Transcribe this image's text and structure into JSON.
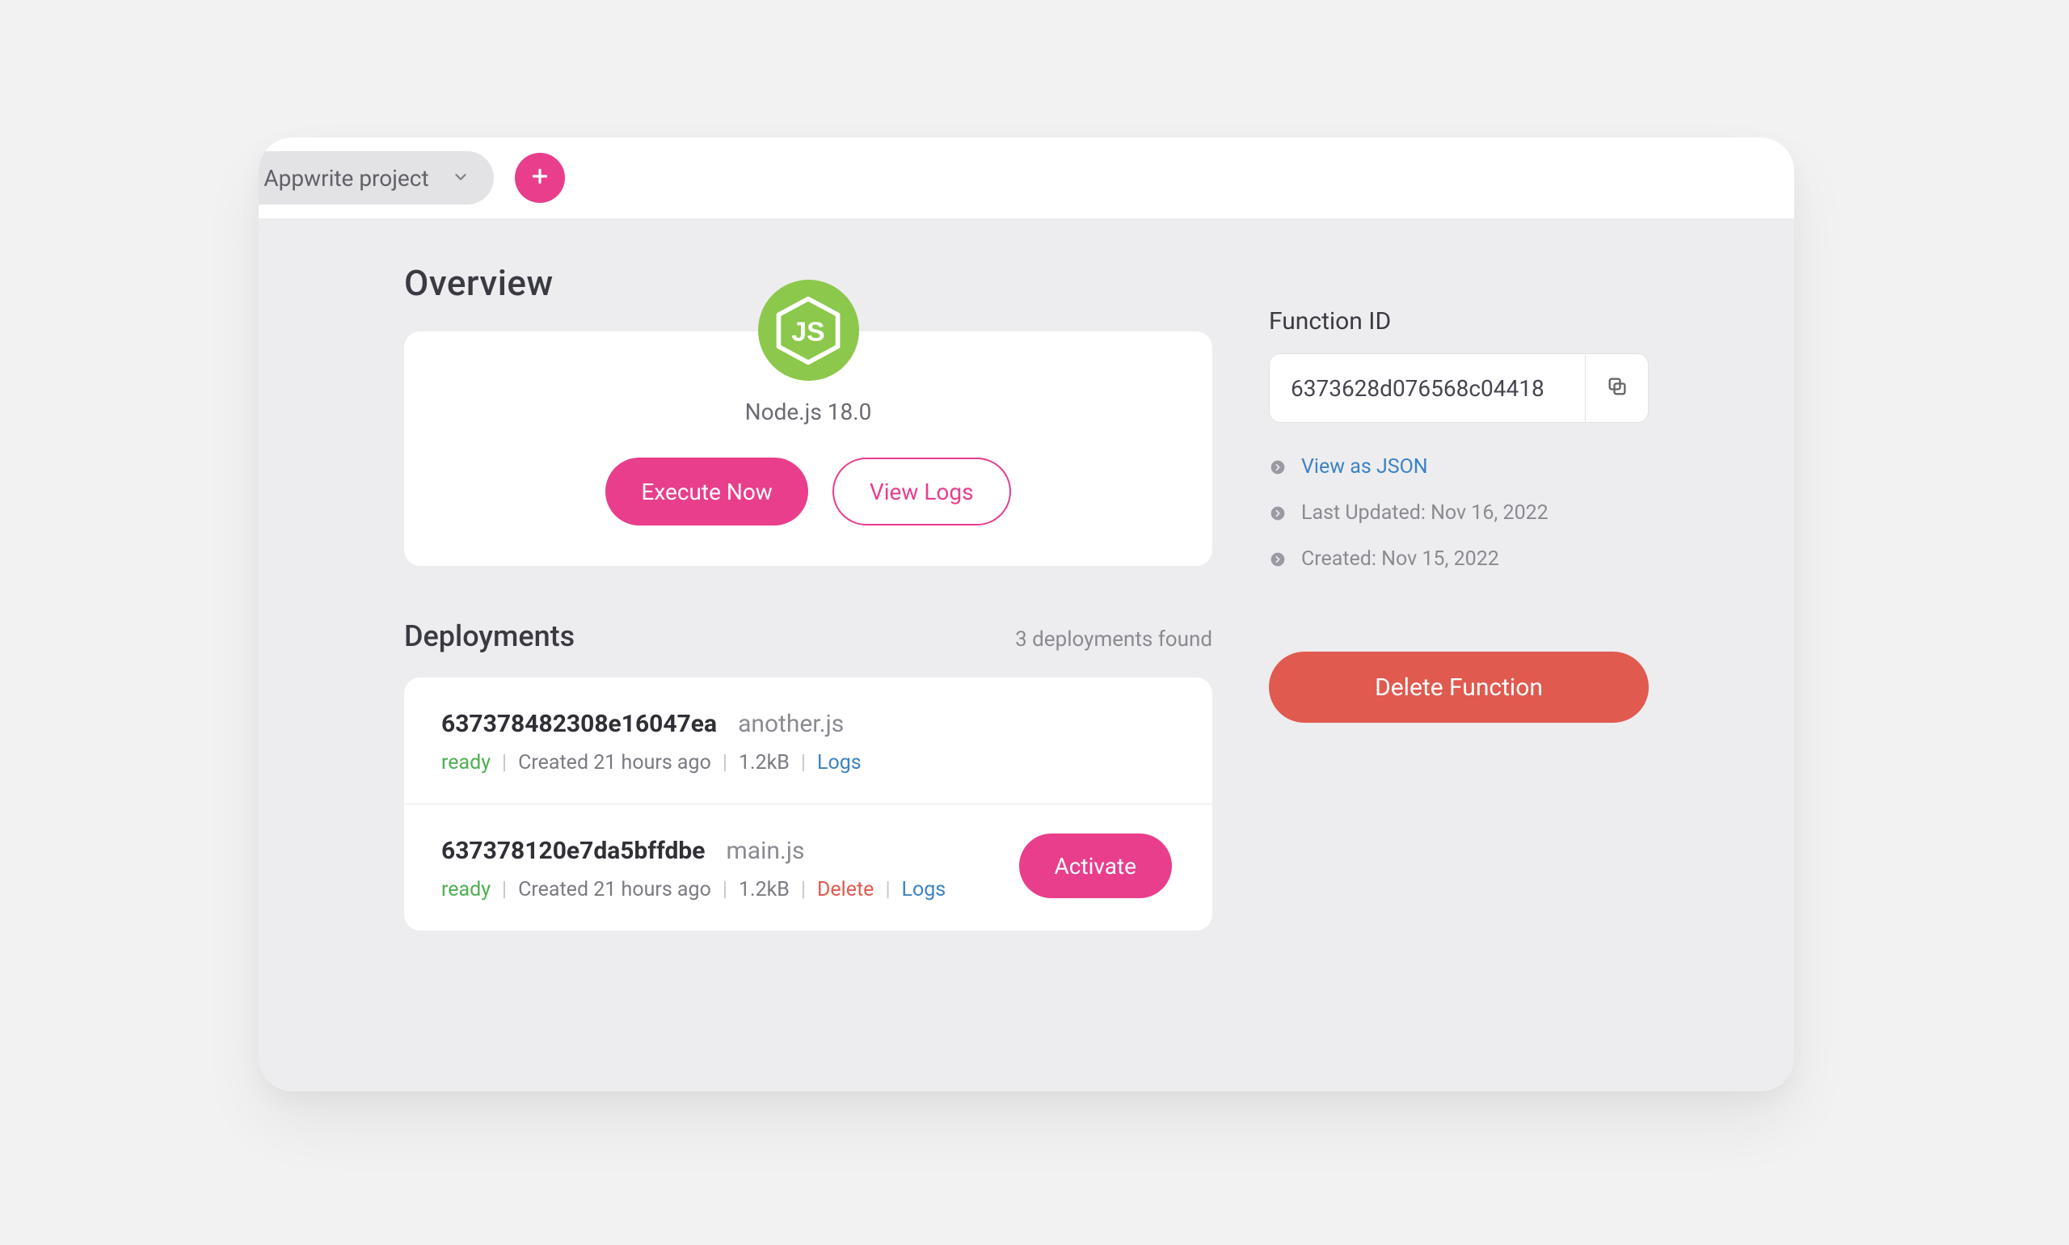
{
  "topbar": {
    "project_label": ". Appwrite project"
  },
  "overview": {
    "heading": "Overview",
    "runtime_name": "Node.js 18.0",
    "execute_label": "Execute Now",
    "view_logs_label": "View Logs"
  },
  "sidebar": {
    "function_id_label": "Function ID",
    "function_id_value": "6373628d076568c04418",
    "view_json_label": "View as JSON",
    "last_updated_label": "Last Updated: Nov 16, 2022",
    "created_label": "Created: Nov 15, 2022",
    "delete_label": "Delete Function"
  },
  "deployments": {
    "heading": "Deployments",
    "count_text": "3 deployments found",
    "items": [
      {
        "id": "637378482308e16047ea",
        "file": "another.js",
        "status": "ready",
        "created": "Created 21 hours ago",
        "size": "1.2kB",
        "logs_label": "Logs",
        "has_activate": false,
        "has_delete": false
      },
      {
        "id": "637378120e7da5bffdbe",
        "file": "main.js",
        "status": "ready",
        "created": "Created 21 hours ago",
        "size": "1.2kB",
        "delete_label": "Delete",
        "logs_label": "Logs",
        "activate_label": "Activate",
        "has_activate": true,
        "has_delete": true
      }
    ]
  }
}
